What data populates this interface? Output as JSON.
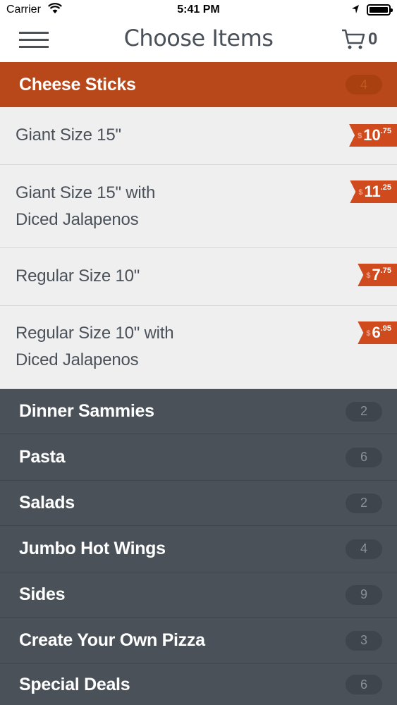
{
  "status_bar": {
    "carrier": "Carrier",
    "time": "5:41 PM"
  },
  "nav": {
    "title": "Choose Items",
    "cart_count": "0"
  },
  "active_category": {
    "label": "Cheese Sticks",
    "count": "4"
  },
  "items": [
    {
      "name_line1": "Giant Size 15\"",
      "name_line2": "",
      "currency": "$",
      "price_whole": "10",
      "price_cents": ".75"
    },
    {
      "name_line1": "Giant Size 15\" with",
      "name_line2": "Diced Jalapenos",
      "currency": "$",
      "price_whole": "11",
      "price_cents": ".25"
    },
    {
      "name_line1": "Regular Size 10\"",
      "name_line2": "",
      "currency": "$",
      "price_whole": "7",
      "price_cents": ".75"
    },
    {
      "name_line1": "Regular Size 10\" with",
      "name_line2": "Diced Jalapenos",
      "currency": "$",
      "price_whole": "6",
      "price_cents": ".95"
    }
  ],
  "categories": [
    {
      "label": "Dinner Sammies",
      "count": "2"
    },
    {
      "label": "Pasta",
      "count": "6"
    },
    {
      "label": "Salads",
      "count": "2"
    },
    {
      "label": "Jumbo Hot Wings",
      "count": "4"
    },
    {
      "label": "Sides",
      "count": "9"
    },
    {
      "label": "Create Your Own Pizza",
      "count": "3"
    },
    {
      "label": "Special Deals",
      "count": "6"
    }
  ],
  "colors": {
    "accent": "#b8481a",
    "price_tag": "#cf4a1c",
    "dark_bg": "#4a5159",
    "item_bg": "#efeff0"
  },
  "icons": {
    "menu": "hamburger-icon",
    "cart": "cart-icon",
    "wifi": "wifi-icon",
    "location": "location-arrow-icon",
    "battery": "battery-icon"
  }
}
